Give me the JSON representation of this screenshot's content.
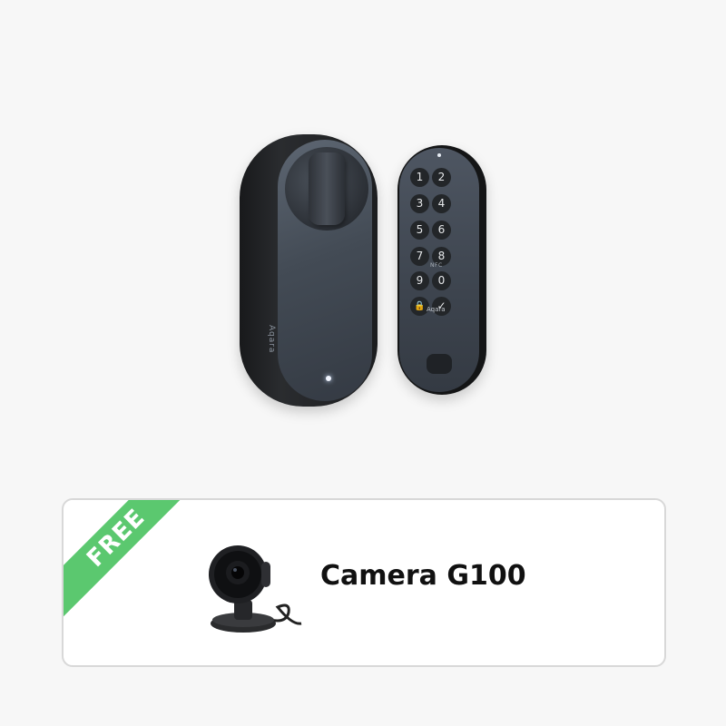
{
  "lock": {
    "brand": "Aqara"
  },
  "keypad": {
    "keys": [
      "1",
      "2",
      "3",
      "4",
      "5",
      "6",
      "7",
      "8",
      "9",
      "0",
      "🔒",
      "✓"
    ],
    "nfc_label": "NFC",
    "brand": "Aqara"
  },
  "promo": {
    "badge": "FREE",
    "product_name": "Camera G100",
    "badge_color": "#5bc86f"
  }
}
